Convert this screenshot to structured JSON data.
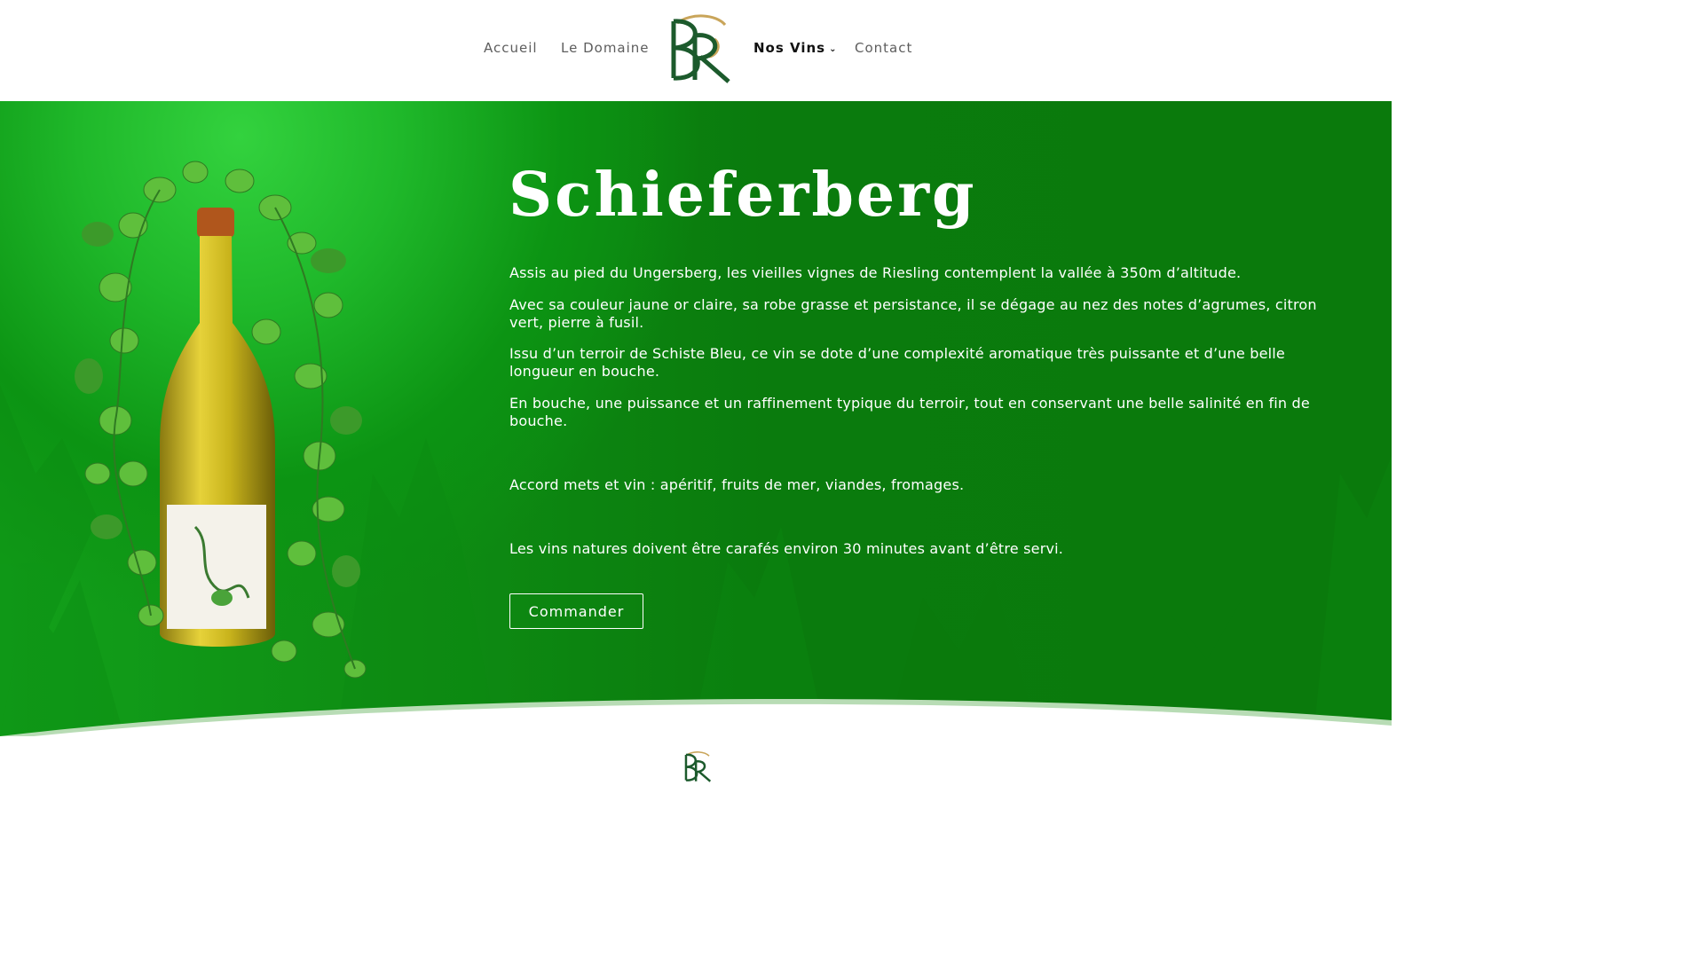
{
  "header": {
    "nav": {
      "accueil": "Accueil",
      "domaine": "Le Domaine",
      "vins": "Nos Vins",
      "contact": "Contact"
    },
    "logo_letters": "BR"
  },
  "hero": {
    "title": "Schieferberg",
    "paragraphs": [
      "Assis au pied du Ungersberg, les vieilles vignes de Riesling contemplent la vallée à 350m d’altitude.",
      "Avec sa couleur jaune or claire, sa robe grasse et persistance, il se dégage au nez des notes d’agrumes, citron vert, pierre à fusil.",
      "Issu d’un terroir de Schiste Bleu, ce vin se dote d’une complexité aromatique très puissante et d’une belle longueur en bouche.",
      "En bouche, une puissance et un raffinement typique du terroir, tout en conservant une belle salinité en fin de bouche.",
      "Accord mets et vin : apéritif, fruits de mer, viandes, fromages.",
      "Les vins natures doivent être carafés environ 30 minutes avant d’être servi."
    ],
    "button_label": "Commander"
  },
  "icons": {
    "dropdown": "chevron-down-icon"
  },
  "colors": {
    "brand_green": "#0a7a0c",
    "hero_light_green": "#33d23e",
    "logo_gold": "#c9a55a",
    "logo_green": "#1c5a2c",
    "nav_text": "#5d5d5d",
    "nav_active": "#111111"
  }
}
